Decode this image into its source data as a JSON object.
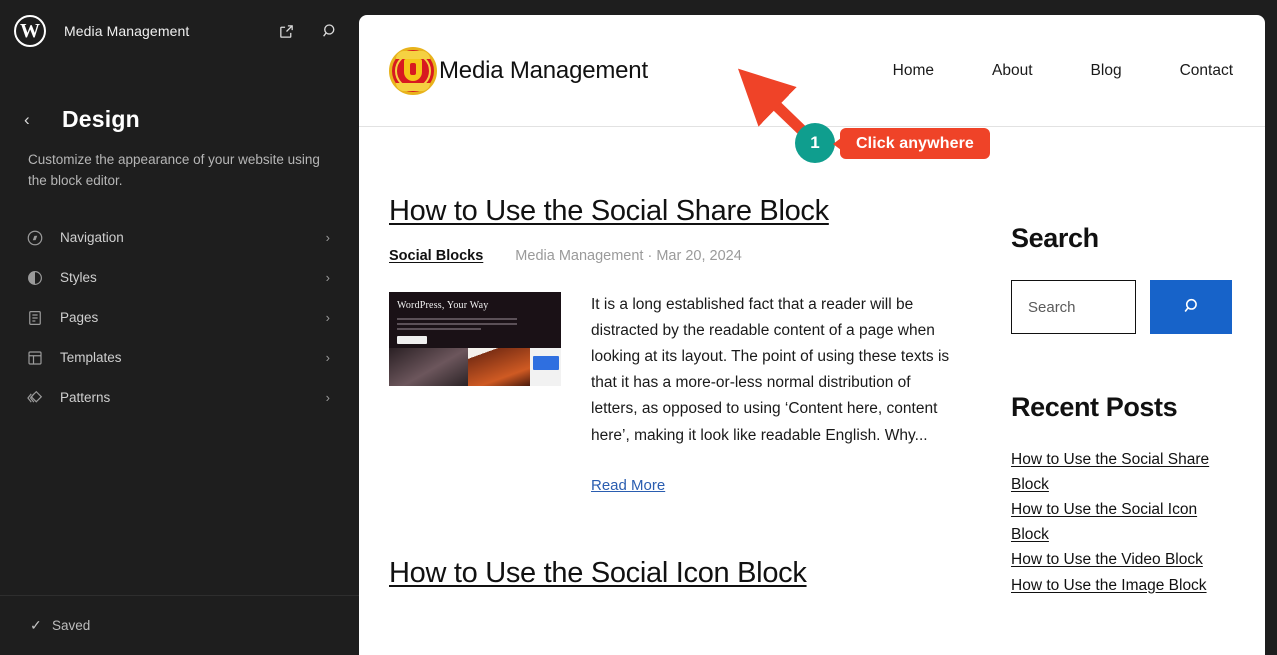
{
  "sidebar": {
    "logo_icon": "wordpress-logo-icon",
    "site_title": "Media Management",
    "view_site_icon": "external-link-icon",
    "search_icon": "search-icon",
    "back_icon": "chevron-left-icon",
    "page_title": "Design",
    "description": "Customize the appearance of your website using the block editor.",
    "items": [
      {
        "label": "Navigation",
        "icon": "navigation-compass-icon",
        "chevron": "›"
      },
      {
        "label": "Styles",
        "icon": "styles-contrast-icon",
        "chevron": "›"
      },
      {
        "label": "Pages",
        "icon": "pages-document-icon",
        "chevron": "›"
      },
      {
        "label": "Templates",
        "icon": "templates-layout-icon",
        "chevron": "›"
      },
      {
        "label": "Patterns",
        "icon": "patterns-stack-icon",
        "chevron": "›"
      }
    ],
    "footer": {
      "check_icon": "check-icon",
      "status": "Saved"
    }
  },
  "site": {
    "logo_icon": "manchester-united-crest-icon",
    "brand_name": "Media Management",
    "nav": [
      {
        "label": "Home"
      },
      {
        "label": "About"
      },
      {
        "label": "Blog"
      },
      {
        "label": "Contact"
      }
    ],
    "posts": [
      {
        "title": "How to Use the Social Share Block",
        "category": "Social Blocks",
        "meta": "Media Management · Mar 20, 2024",
        "thumbnail_title": "WordPress, Your Way",
        "excerpt": "It is a long established fact that a reader will be distracted by the readable content of a page when looking at its layout. The point of using these texts is that it has a more-or-less normal distribution of letters, as opposed to using ‘Content here, content here’, making it look like readable English. Why...",
        "read_more": "Read More"
      },
      {
        "title": "How to Use the Social Icon Block"
      }
    ],
    "sidebar": {
      "search_heading": "Search",
      "search_placeholder": "Search",
      "search_value": "",
      "search_button_icon": "search-icon",
      "search_button_color": "#1763c9",
      "recent_heading": "Recent Posts",
      "recent_posts": [
        {
          "label": "How to Use the Social Share Block"
        },
        {
          "label": "How to Use the Social Icon Block"
        },
        {
          "label": "How to Use the Video Block"
        },
        {
          "label": "How to Use the Image Block"
        }
      ]
    }
  },
  "annotation": {
    "step_number": "1",
    "tooltip": "Click anywhere",
    "badge_color": "#0f9e8e",
    "tooltip_color": "#ef4328",
    "arrow_icon": "arrow-up-left-icon"
  }
}
